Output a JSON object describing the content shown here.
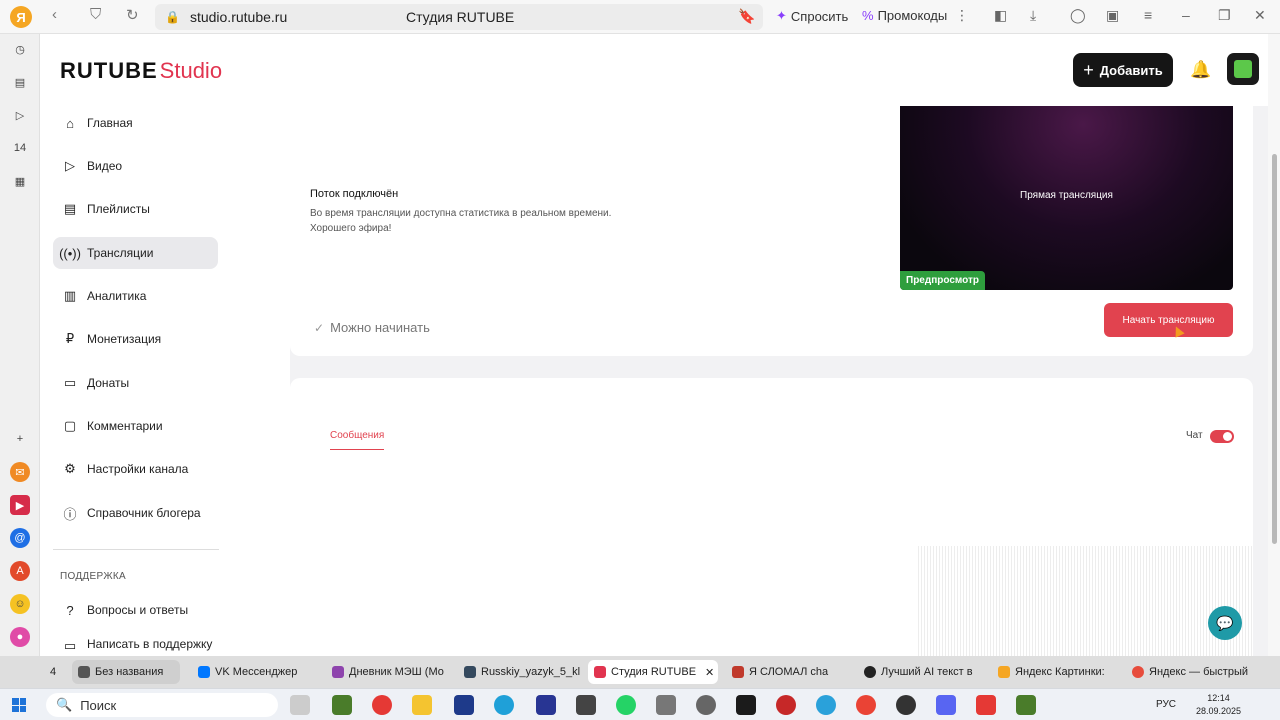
{
  "browser": {
    "url": "studio.rutube.ru",
    "title": "Студия RUTUBE",
    "ask_label": "Спросить",
    "promo_label": "Промокоды"
  },
  "header": {
    "logo_main": "RUTUBE",
    "logo_studio": "Studio",
    "add_button": "Добавить"
  },
  "nav": {
    "items": [
      {
        "label": "Главная",
        "icon": "home-icon"
      },
      {
        "label": "Видео",
        "icon": "video-icon"
      },
      {
        "label": "Плейлисты",
        "icon": "playlist-icon"
      },
      {
        "label": "Трансляции",
        "icon": "broadcast-icon",
        "active": true
      },
      {
        "label": "Аналитика",
        "icon": "analytics-icon"
      },
      {
        "label": "Монетизация",
        "icon": "money-icon"
      },
      {
        "label": "Донаты",
        "icon": "wallet-icon"
      },
      {
        "label": "Комментарии",
        "icon": "comment-icon"
      },
      {
        "label": "Настройки канала",
        "icon": "gear-icon"
      },
      {
        "label": "Справочник блогера",
        "icon": "info-icon"
      }
    ],
    "support_title": "ПОДДЕРЖКА",
    "support_items": [
      {
        "label": "Вопросы и ответы",
        "icon": "question-icon"
      },
      {
        "label": "Написать в поддержку",
        "icon": "message-icon"
      }
    ]
  },
  "stream": {
    "status_title": "Поток подключён",
    "status_desc_1": "Во время трансляции доступна статистика в реальном времени.",
    "status_desc_2": "Хорошего эфира!",
    "preview_label": "Прямая трансляция",
    "preview_badge": "Предпросмотр",
    "ready_text": "Можно начинать",
    "start_button": "Начать трансляцию"
  },
  "chat": {
    "tab_messages": "Сообщения",
    "chat_label": "Чат",
    "chat_enabled": true
  },
  "tabs": [
    {
      "label": "Без названия",
      "color": "#555555"
    },
    {
      "label": "VK Мессенджер",
      "color": "#0077ff"
    },
    {
      "label": "Дневник МЭШ (Мо",
      "color": "#8e44ad"
    },
    {
      "label": "Russkiy_yazyk_5_kl",
      "color": "#34495e"
    },
    {
      "label": "Студия RUTUBE",
      "color": "#e1344f",
      "active": true
    },
    {
      "label": "Я СЛОМАЛ cha",
      "color": "#c0392b"
    },
    {
      "label": "Лучший AI текст в",
      "color": "#222222"
    },
    {
      "label": "Яндекс Картинки:",
      "color": "#f5a623"
    },
    {
      "label": "Яндекс — быстрый",
      "color": "#e74c3c"
    }
  ],
  "tab_count": "4",
  "taskbar": {
    "search_placeholder": "Поиск",
    "time": "12:14",
    "date": "28.09.2025",
    "lang": "РУС"
  }
}
